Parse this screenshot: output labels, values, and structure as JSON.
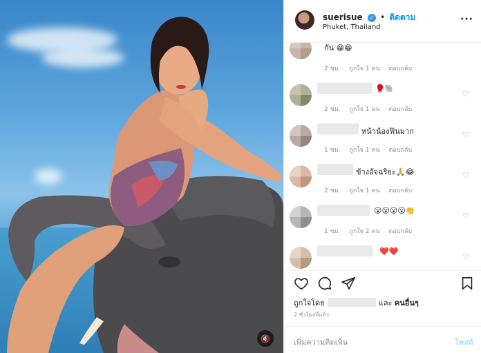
{
  "header": {
    "username": "suerisue",
    "separator": "•",
    "follow_label": "ติดตาม",
    "location": "Phuket, Thailand",
    "more_icon": "more-icon"
  },
  "comments": [
    {
      "text": "กัน 😁😁",
      "time": "2 ชม.",
      "likes": "ถูกใจ 1 คน",
      "reply": "ตอบกลับ"
    },
    {
      "text": "🥊🐘",
      "time": "2 ชม.",
      "likes": "ถูกใจ 1 คน",
      "reply": "ตอบกลับ"
    },
    {
      "text": "หน้าน้องฟินมาก",
      "time": "1 ชม.",
      "likes": "ถูกใจ 1 คน",
      "reply": "ตอบกลับ"
    },
    {
      "text": "ข้างอัจฉริยะ🙏😂",
      "time": "2 ชม.",
      "likes": "ถูกใจ 1 คน",
      "reply": "ตอบกลับ"
    },
    {
      "text": "😮😮😮😮👏",
      "time": "1 ชม.",
      "likes": "ถูกใจ 2 คน",
      "reply": "ตอบกลับ"
    },
    {
      "text": "❤️❤️",
      "time": "",
      "likes": "",
      "reply": ""
    }
  ],
  "footer": {
    "liked_by_prefix": "ถูกใจโดย",
    "liked_by_and": "และ",
    "liked_by_others": "คนอื่นๆ",
    "timestamp": "2 ชั่วโมงที่แล้ว",
    "add_comment_placeholder": "เพิ่มความคิดเห็น",
    "post_label": "โพสต์"
  },
  "colors": {
    "accent": "#0095f6",
    "verified": "#3897f0",
    "meta_text": "#8e8e8e"
  }
}
